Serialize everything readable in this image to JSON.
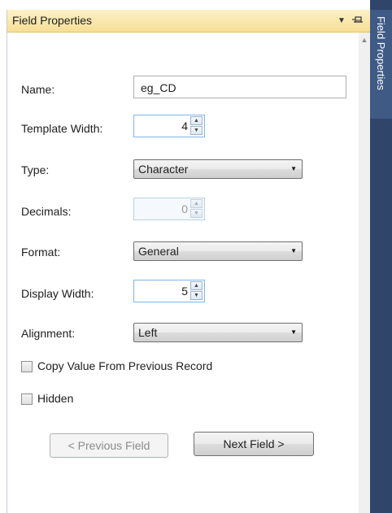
{
  "panel": {
    "title": "Field Properties",
    "side_tab_label": "Field Properties"
  },
  "form": {
    "name_label": "Name:",
    "name_value": "eg_CD",
    "template_width_label": "Template Width:",
    "template_width_value": "4",
    "type_label": "Type:",
    "type_value": "Character",
    "decimals_label": "Decimals:",
    "decimals_value": "0",
    "format_label": "Format:",
    "format_value": "General",
    "display_width_label": "Display Width:",
    "display_width_value": "5",
    "alignment_label": "Alignment:",
    "alignment_value": "Left",
    "copy_value_label": "Copy Value From Previous Record",
    "hidden_label": "Hidden"
  },
  "buttons": {
    "previous_label": "< Previous Field",
    "next_label": "Next Field >"
  },
  "colors": {
    "titlebar_top": "#fdf2c7",
    "titlebar_bottom": "#f6de96",
    "side_strip": "#2f4569",
    "side_tab": "#3f5a84"
  }
}
